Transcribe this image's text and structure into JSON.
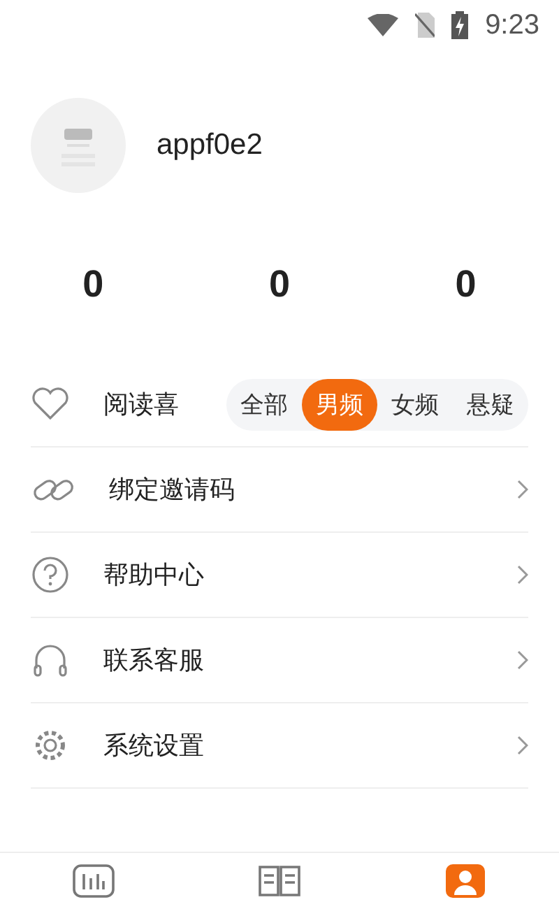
{
  "status_bar": {
    "time": "9:23"
  },
  "profile": {
    "username": "appf0e2"
  },
  "stats": [
    "0",
    "0",
    "0"
  ],
  "menu": [
    {
      "kind": "preference",
      "label": "阅读喜",
      "options": [
        {
          "label": "全部",
          "selected": false
        },
        {
          "label": "男频",
          "selected": true
        },
        {
          "label": "女频",
          "selected": false
        },
        {
          "label": "悬疑",
          "selected": false
        }
      ]
    },
    {
      "kind": "link",
      "label": "绑定邀请码"
    },
    {
      "kind": "link",
      "label": "帮助中心"
    },
    {
      "kind": "link",
      "label": "联系客服"
    },
    {
      "kind": "link",
      "label": "系统设置"
    }
  ],
  "bottom_nav": [
    {
      "selected": false
    },
    {
      "selected": false
    },
    {
      "selected": true
    }
  ]
}
